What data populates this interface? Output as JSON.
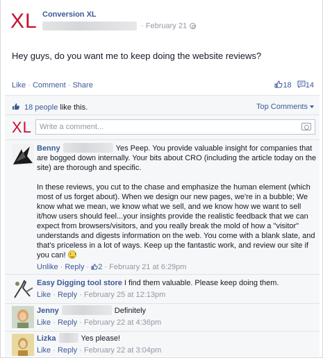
{
  "post": {
    "logo_text": "XL",
    "page_name": "Conversion XL",
    "date": "February 21",
    "text": "Hey guys, do you want me to keep doing the website reviews?",
    "actions": {
      "like": "Like",
      "comment": "Comment",
      "share": "Share"
    },
    "like_count": "18",
    "comment_count": "14"
  },
  "ufi": {
    "likes_link": "18 people",
    "likes_suffix": " like this.",
    "sort_label": "Top Comments",
    "compose": {
      "logo_text": "XL",
      "placeholder": "Write a comment..."
    }
  },
  "comments": [
    {
      "name": "Benny",
      "paragraph1": "Yes Peep. You provide valuable insight for companies that are bogged down internally. Your bits about CRO (including the article today on the site) are thorough and specific.",
      "paragraph2": "In these reviews, you cut to the chase and emphasize the human element (which most of us forget about). When we design our new pages, we're in a bubble; We know what we mean, we know what we sell, and we know how we want to sell it/how users should feel...your insights provide the realistic feedback that we can expect from browsers/visitors, and you really break the mold of how a \"visitor\" understands and digests information on the web. You come with a blank slate, and that's priceless in a lot of ways. Keep up the fantastic work, and review our site if you can!",
      "action": "Unlike",
      "reply": "Reply",
      "likes": "2",
      "time": "February 21 at 6:29pm"
    },
    {
      "name": "Easy Digging tool store",
      "text": "I find them valuable. Please keep doing them.",
      "action": "Like",
      "reply": "Reply",
      "time": "February 25 at 12:13pm"
    },
    {
      "name": "Jenny",
      "text": "Definitely",
      "action": "Like",
      "reply": "Reply",
      "time": "February 22 at 4:36pm"
    },
    {
      "name": "Lizka",
      "text": "Yes please!",
      "action": "Like",
      "reply": "Reply",
      "time": "February 22 at 3:04pm"
    }
  ],
  "colors": {
    "brand_logo": "#c8102e",
    "link": "#3b5998",
    "meta": "#9197a3"
  }
}
